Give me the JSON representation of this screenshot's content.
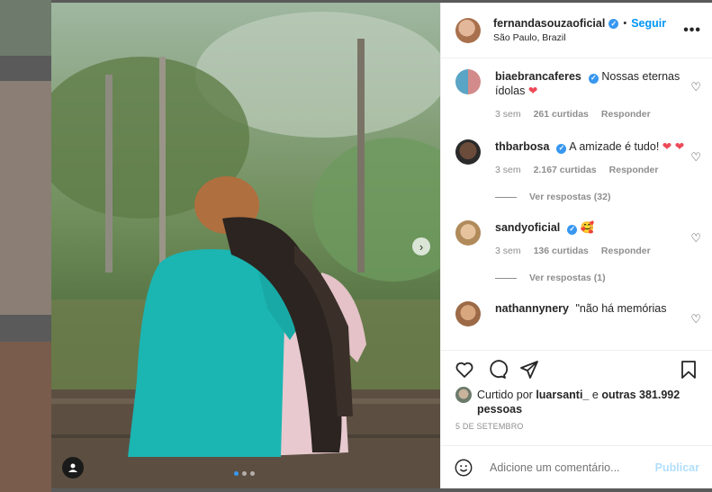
{
  "post": {
    "author": "fernandasouzaoficial",
    "location": "São Paulo, Brazil",
    "follow_label": "Seguir",
    "separator": "•",
    "more_label": "•••"
  },
  "comments": [
    {
      "user": "biaebrancaferes",
      "text": "Nossas eternas ídolas",
      "emoji": "❤",
      "time": "3 sem",
      "likes": "261 curtidas",
      "reply": "Responder",
      "replies": ""
    },
    {
      "user": "thbarbosa",
      "text": "A amizade é tudo!",
      "emoji": "❤ ❤",
      "time": "3 sem",
      "likes": "2.167 curtidas",
      "reply": "Responder",
      "replies": "Ver respostas (32)"
    },
    {
      "user": "sandyoficial",
      "text": "",
      "emoji": "🥰",
      "time": "3 sem",
      "likes": "136 curtidas",
      "reply": "Responder",
      "replies": "Ver respostas (1)"
    },
    {
      "user": "nathannynery",
      "text": "\"não há memórias",
      "emoji": "",
      "time": "",
      "likes": "",
      "reply": "",
      "replies": ""
    }
  ],
  "likes": {
    "prefix": "Curtido por",
    "user": "luarsanti_",
    "joiner": "e",
    "others": "outras 381.992 pessoas"
  },
  "date": "5 DE SETEMBRO",
  "add_comment": {
    "placeholder": "Adicione um comentário...",
    "publish": "Publicar"
  },
  "icons": {
    "next": "chevron-right-icon",
    "tag": "user-tag-icon",
    "heart": "heart-icon",
    "comment": "comment-icon",
    "share": "share-icon",
    "save": "bookmark-icon",
    "emoji": "emoji-icon"
  },
  "colors": {
    "accent": "#0095f6",
    "verified": "#3897f0",
    "muted": "#8e8e8e",
    "heart": "#ed4956"
  }
}
